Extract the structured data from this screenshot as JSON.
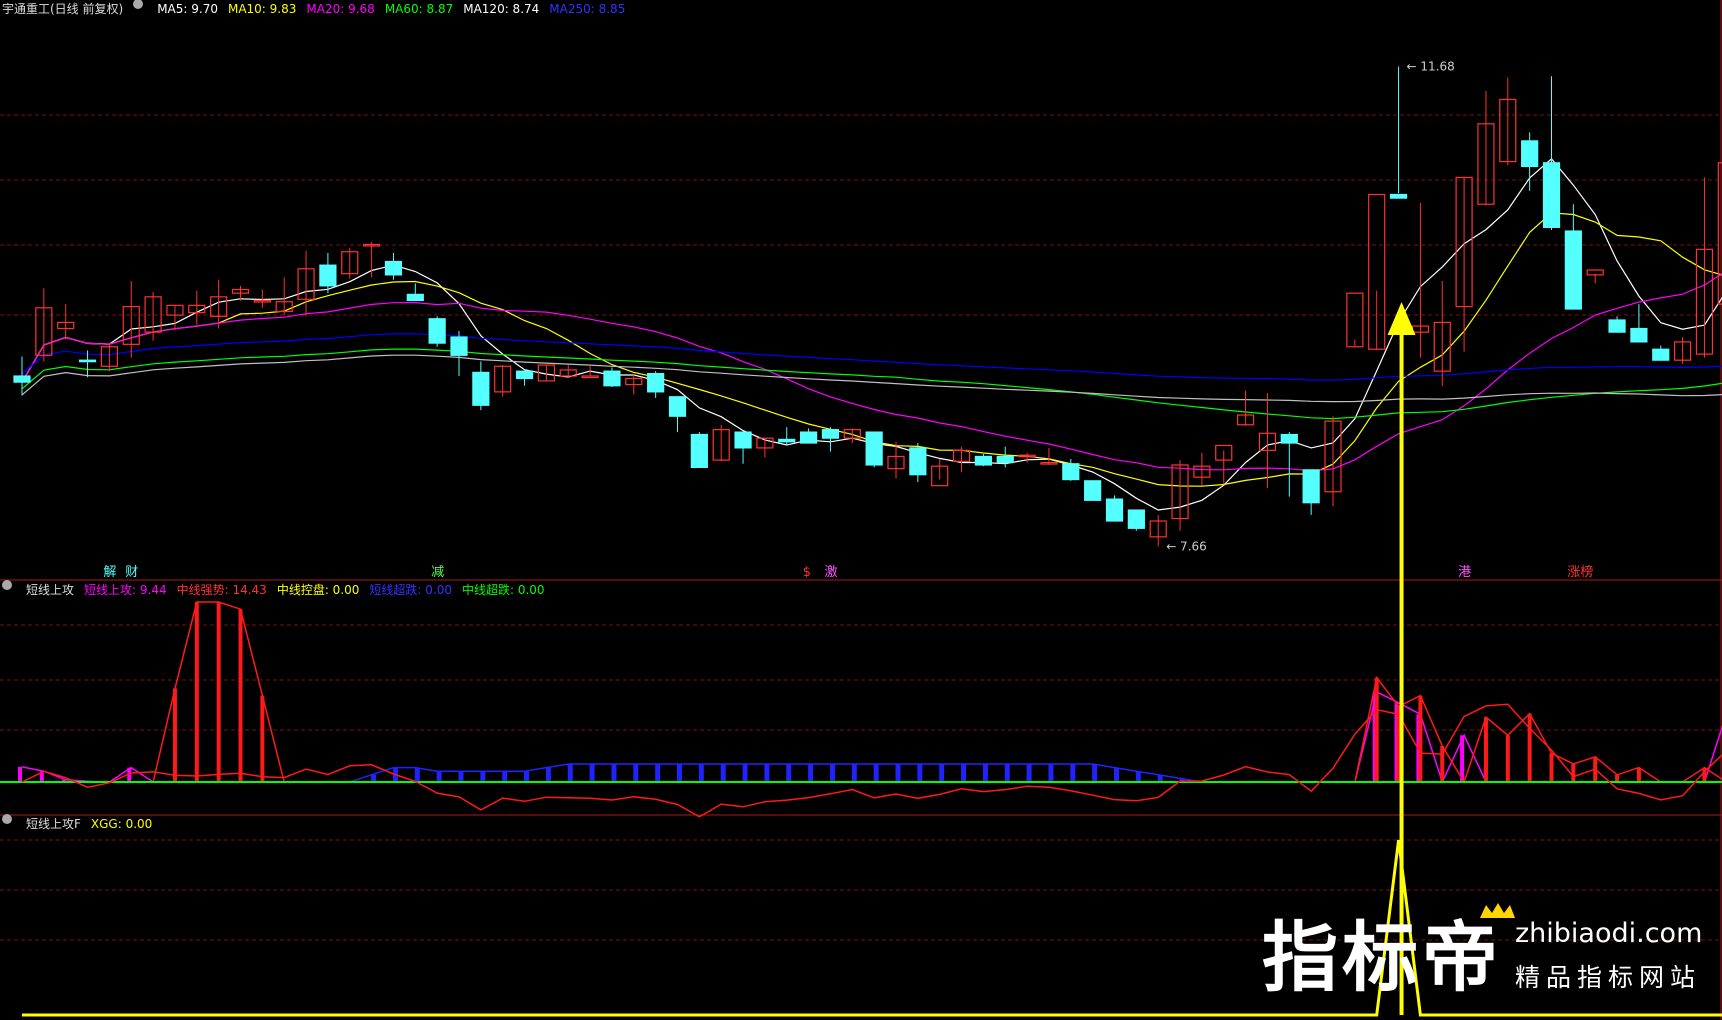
{
  "colors": {
    "ma5": "#ffffff",
    "ma10": "#ffff00",
    "ma20": "#ff00ff",
    "ma60": "#00ff00",
    "ma120": "#c0c0c0",
    "ma250": "#0000ff",
    "up": "#ff3232",
    "down": "#54ffff",
    "grid": "#7a1010"
  },
  "main": {
    "stock_title": "宇通重工(日线 前复权)",
    "legend": [
      {
        "label": "MA5: 9.70",
        "color": "#ffffff"
      },
      {
        "label": "MA10: 9.83",
        "color": "#ffff00"
      },
      {
        "label": "MA20: 9.68",
        "color": "#ff00ff"
      },
      {
        "label": "MA60: 8.87",
        "color": "#00ff00"
      },
      {
        "label": "MA120: 8.74",
        "color": "#ffffff"
      },
      {
        "label": "MA250: 8.85",
        "color": "#3232ff"
      }
    ],
    "high_label": "11.68",
    "low_label": "7.66",
    "events": [
      {
        "text": "解",
        "color": "#54ffff"
      },
      {
        "text": "财",
        "color": "#54ffff"
      },
      {
        "text": "减",
        "color": "#54ff54"
      },
      {
        "text": "$",
        "color": "#ff3232"
      },
      {
        "text": "激",
        "color": "#ff55ff"
      },
      {
        "text": "港",
        "color": "#ff55ff"
      },
      {
        "text": "涨榜",
        "color": "#ff3232"
      }
    ]
  },
  "panel1": {
    "name": "短线上攻",
    "legend": [
      {
        "label": "短线上攻: 9.44",
        "color": "#ff00ff"
      },
      {
        "label": "中线强势: 14.43",
        "color": "#ff3232"
      },
      {
        "label": "中线控盘: 0.00",
        "color": "#ffff00"
      },
      {
        "label": "短线超跌: 0.00",
        "color": "#3232ff"
      },
      {
        "label": "中线超跌: 0.00",
        "color": "#00ff00"
      }
    ]
  },
  "panel2": {
    "name": "短线上攻F",
    "legend": [
      {
        "label": "XGG: 0.00",
        "color": "#ffff00"
      }
    ]
  },
  "watermark": {
    "big": "指标帝",
    "url": "zhibiaodi.com",
    "sub": "精品指标网站"
  },
  "chart_data": [
    {
      "type": "candlestick",
      "title": "宇通重工(日线 前复权)",
      "ohlc": [
        [
          9.06,
          9.22,
          8.9,
          9.01
        ],
        [
          9.23,
          9.78,
          9.18,
          9.62
        ],
        [
          9.45,
          9.65,
          9.36,
          9.5
        ],
        [
          9.19,
          9.27,
          9.05,
          9.18
        ],
        [
          9.14,
          9.33,
          9.1,
          9.3
        ],
        [
          9.32,
          9.84,
          9.21,
          9.63
        ],
        [
          9.42,
          9.75,
          9.35,
          9.71
        ],
        [
          9.56,
          9.64,
          9.44,
          9.64
        ],
        [
          9.58,
          9.76,
          9.48,
          9.64
        ],
        [
          9.55,
          9.85,
          9.45,
          9.71
        ],
        [
          9.74,
          9.8,
          9.68,
          9.77
        ],
        [
          9.68,
          9.77,
          9.62,
          9.68
        ],
        [
          9.59,
          9.87,
          9.56,
          9.67
        ],
        [
          9.69,
          10.09,
          9.55,
          9.94
        ],
        [
          9.97,
          10.07,
          9.74,
          9.8
        ],
        [
          9.9,
          10.11,
          9.86,
          10.08
        ],
        [
          10.14,
          10.16,
          9.87,
          10.14
        ],
        [
          10.0,
          10.07,
          9.85,
          9.89
        ],
        [
          9.73,
          9.82,
          9.68,
          9.68
        ],
        [
          9.53,
          9.55,
          9.3,
          9.33
        ],
        [
          9.38,
          9.43,
          9.06,
          9.23
        ],
        [
          9.09,
          9.18,
          8.78,
          8.82
        ],
        [
          8.93,
          9.15,
          8.89,
          9.14
        ],
        [
          9.1,
          9.1,
          8.98,
          9.04
        ],
        [
          9.02,
          9.15,
          9.02,
          9.15
        ],
        [
          9.06,
          9.15,
          9.05,
          9.11
        ],
        [
          9.05,
          9.15,
          9.06,
          9.06
        ],
        [
          9.1,
          9.13,
          8.97,
          8.98
        ],
        [
          8.99,
          9.07,
          8.91,
          9.04
        ],
        [
          9.08,
          9.1,
          8.88,
          8.93
        ],
        [
          8.89,
          8.89,
          8.6,
          8.73
        ],
        [
          8.58,
          8.6,
          8.33,
          8.31
        ],
        [
          8.37,
          8.66,
          8.36,
          8.62
        ],
        [
          8.6,
          8.6,
          8.34,
          8.47
        ],
        [
          8.47,
          8.55,
          8.39,
          8.55
        ],
        [
          8.54,
          8.64,
          8.5,
          8.52
        ],
        [
          8.6,
          8.63,
          8.51,
          8.51
        ],
        [
          8.62,
          8.64,
          8.44,
          8.55
        ],
        [
          8.55,
          8.63,
          8.51,
          8.62
        ],
        [
          8.6,
          8.6,
          8.31,
          8.33
        ],
        [
          8.3,
          8.52,
          8.22,
          8.4
        ],
        [
          8.47,
          8.51,
          8.19,
          8.25
        ],
        [
          8.16,
          8.38,
          8.21,
          8.32
        ],
        [
          8.36,
          8.48,
          8.27,
          8.45
        ],
        [
          8.4,
          8.42,
          8.32,
          8.33
        ],
        [
          8.4,
          8.48,
          8.31,
          8.35
        ],
        [
          8.41,
          8.43,
          8.35,
          8.41
        ],
        [
          8.35,
          8.47,
          8.33,
          8.35
        ],
        [
          8.34,
          8.38,
          8.2,
          8.21
        ],
        [
          8.2,
          8.2,
          8.05,
          8.04
        ],
        [
          8.05,
          8.08,
          7.9,
          7.87
        ],
        [
          7.96,
          7.96,
          7.79,
          7.81
        ],
        [
          7.74,
          7.92,
          7.66,
          7.87
        ],
        [
          7.89,
          8.37,
          7.79,
          8.33
        ],
        [
          8.23,
          8.43,
          8.16,
          8.32
        ],
        [
          8.37,
          8.45,
          8.17,
          8.49
        ],
        [
          8.66,
          8.94,
          8.65,
          8.74
        ],
        [
          8.45,
          8.92,
          8.14,
          8.59
        ],
        [
          8.58,
          8.6,
          8.07,
          8.51
        ],
        [
          8.29,
          8.28,
          7.92,
          8.02
        ],
        [
          8.11,
          8.73,
          7.99,
          8.69
        ],
        [
          9.3,
          9.36,
          9.3,
          9.74
        ],
        [
          9.28,
          9.76,
          9.28,
          10.55
        ],
        [
          10.55,
          11.6,
          10.56,
          10.52
        ],
        [
          9.42,
          10.48,
          9.21,
          9.47
        ],
        [
          9.1,
          9.84,
          8.98,
          9.5
        ],
        [
          9.63,
          10.69,
          9.26,
          10.69
        ],
        [
          10.47,
          11.4,
          10.46,
          11.13
        ],
        [
          10.82,
          11.51,
          10.79,
          11.33
        ],
        [
          10.99,
          11.06,
          10.58,
          10.78
        ],
        [
          10.81,
          11.52,
          10.26,
          10.28
        ],
        [
          10.25,
          10.47,
          10.13,
          9.61
        ],
        [
          9.89,
          9.9,
          9.82,
          9.93
        ],
        [
          9.52,
          9.55,
          9.51,
          9.42
        ],
        [
          9.45,
          9.65,
          9.42,
          9.34
        ],
        [
          9.28,
          9.31,
          9.25,
          9.19
        ],
        [
          9.19,
          9.38,
          9.16,
          9.34
        ],
        [
          9.24,
          10.69,
          9.21,
          10.1
        ],
        [
          9.65,
          11.11,
          9.63,
          10.81
        ]
      ]
    },
    {
      "type": "bar",
      "title": "短线上攻",
      "series": [
        {
          "name": "短线上攻",
          "values": [
            2.1,
            1.5,
            0.3,
            0.1,
            0,
            2.0,
            0,
            0,
            0,
            0,
            0,
            0,
            0,
            0,
            0,
            0,
            0,
            0,
            0,
            0,
            0,
            0,
            0,
            0,
            0,
            0,
            0,
            0,
            0,
            0,
            0,
            0,
            0,
            0,
            0,
            0,
            0,
            0,
            0,
            0,
            0,
            0,
            0,
            0,
            0,
            0,
            0,
            0,
            0,
            0,
            0,
            0,
            0,
            0,
            0,
            0,
            0,
            0,
            0,
            0,
            0,
            0,
            12.5,
            11.0,
            9.4,
            0,
            6.5,
            0,
            0,
            0,
            0,
            0,
            0,
            0,
            0,
            0,
            0,
            0,
            9.44
          ]
        },
        {
          "name": "中线强势",
          "values": [
            0,
            0,
            0,
            0,
            0,
            0,
            0,
            13.0,
            25.0,
            25.0,
            24.0,
            12.0,
            0,
            0,
            0,
            0,
            0,
            0,
            0,
            0,
            0,
            0,
            0,
            0,
            0,
            0,
            0,
            0,
            0,
            0,
            0,
            0,
            0,
            0,
            0,
            0,
            0,
            0,
            0,
            0,
            0,
            0,
            0,
            0,
            0,
            0,
            0,
            0,
            0,
            0,
            0,
            0,
            0,
            0,
            0,
            0,
            0,
            0,
            0,
            0,
            0,
            0,
            14.5,
            10.5,
            12.0,
            5.0,
            0,
            9.0,
            6.5,
            9.5,
            4.0,
            2.5,
            3.5,
            1.0,
            2.0,
            0,
            0,
            2.0,
            0,
            14.43
          ]
        },
        {
          "name": "短线超跌",
          "values": [
            0,
            0,
            0,
            0,
            0,
            0,
            0,
            0,
            0,
            0,
            0,
            0,
            0,
            0,
            0,
            0,
            1.0,
            2.0,
            2.0,
            1.5,
            1.5,
            1.5,
            1.5,
            1.5,
            2.0,
            2.5,
            2.5,
            2.5,
            2.5,
            2.5,
            2.5,
            2.5,
            2.5,
            2.5,
            2.5,
            2.5,
            2.5,
            2.5,
            2.5,
            2.5,
            2.5,
            2.5,
            2.5,
            2.5,
            2.5,
            2.5,
            2.5,
            2.5,
            2.5,
            2.5,
            2.0,
            1.5,
            1.0,
            0.5,
            0,
            0,
            0,
            0,
            0,
            0,
            0,
            0,
            0,
            0,
            0,
            0,
            0,
            0,
            0,
            0,
            0,
            0,
            0,
            0,
            0,
            0,
            0,
            0,
            0
          ]
        }
      ]
    },
    {
      "type": "line",
      "title": "短线上攻F",
      "series": [
        {
          "name": "XGG",
          "values": [
            0,
            0,
            0,
            0,
            0,
            0,
            0,
            0,
            0,
            0,
            0,
            0,
            0,
            0,
            0,
            0,
            0,
            0,
            0,
            0,
            0,
            0,
            0,
            0,
            0,
            0,
            0,
            0,
            0,
            0,
            0,
            0,
            0,
            0,
            0,
            0,
            0,
            0,
            0,
            0,
            0,
            0,
            0,
            0,
            0,
            0,
            0,
            0,
            0,
            0,
            0,
            0,
            0,
            0,
            0,
            0,
            0,
            0,
            0,
            0,
            0,
            0,
            0,
            1,
            0,
            0,
            0,
            0,
            0,
            0,
            0,
            0,
            0,
            0,
            0,
            0,
            0,
            0,
            0
          ]
        }
      ]
    }
  ]
}
